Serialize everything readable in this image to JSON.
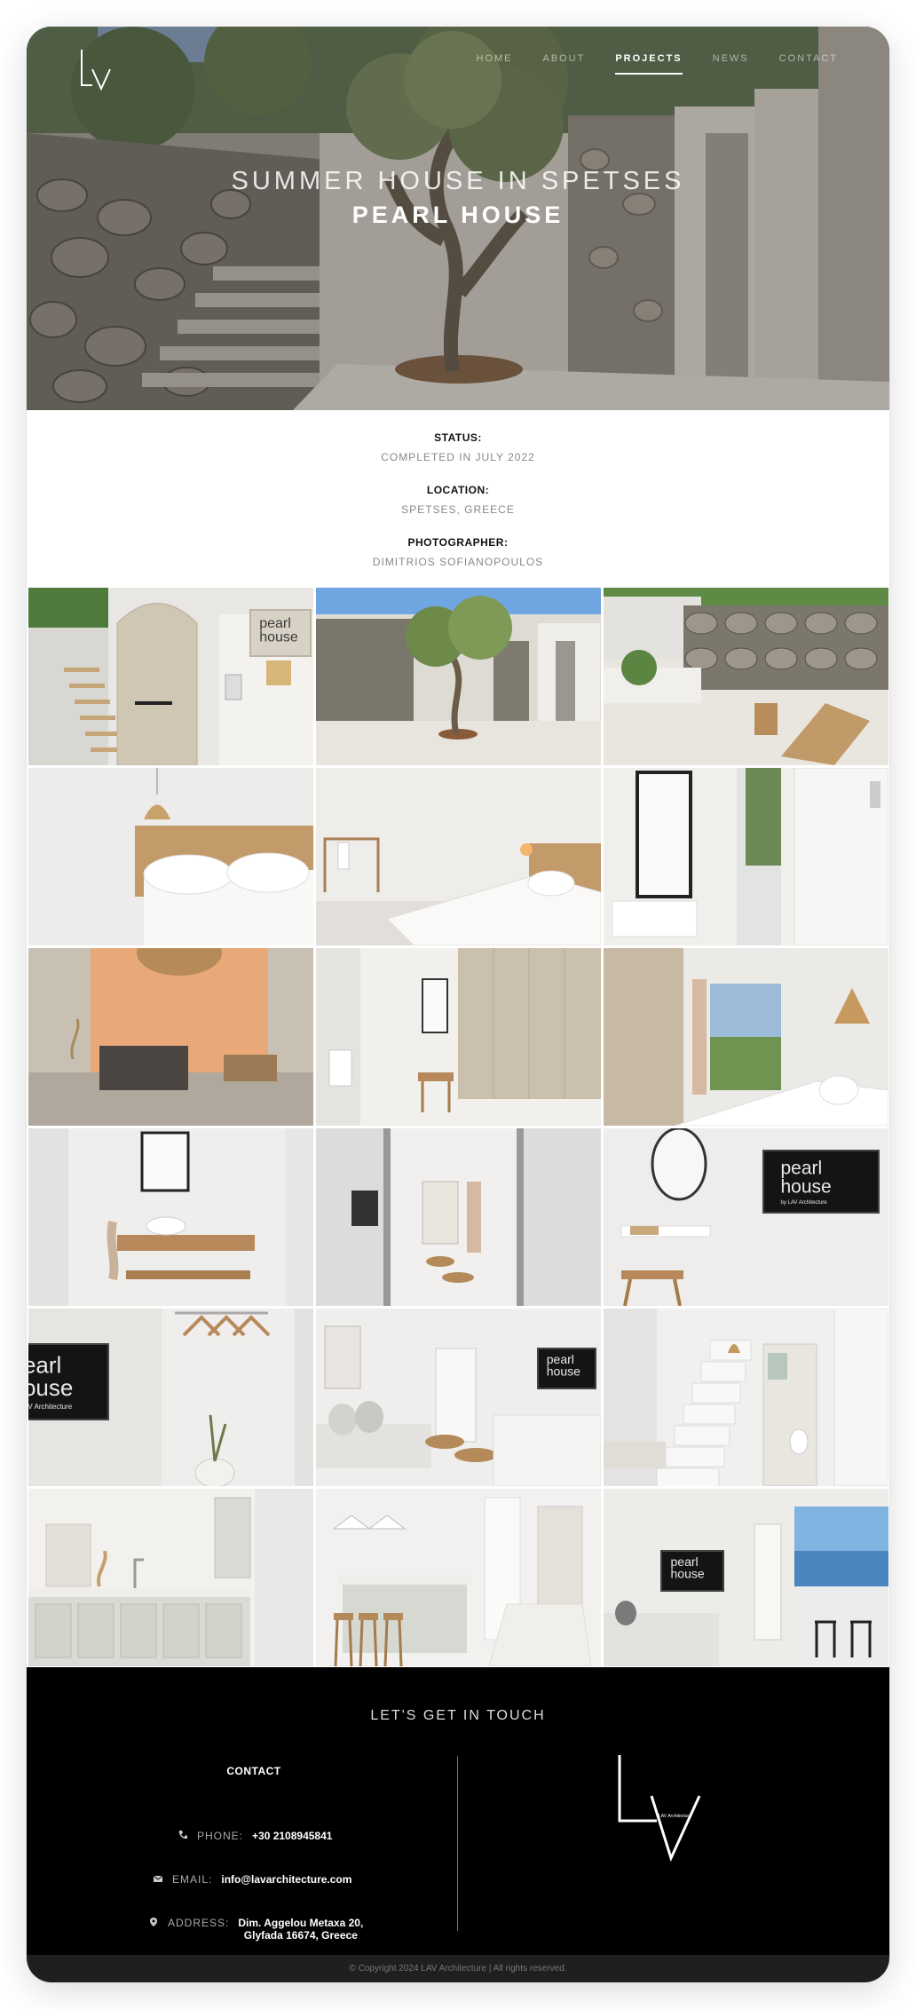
{
  "header": {
    "logo_alt": "LV",
    "nav": [
      {
        "label": "HOME",
        "active": false
      },
      {
        "label": "ABOUT",
        "active": false
      },
      {
        "label": "PROJECTS",
        "active": true
      },
      {
        "label": "NEWS",
        "active": false
      },
      {
        "label": "CONTACT",
        "active": false
      }
    ]
  },
  "hero": {
    "title": "SUMMER HOUSE IN SPETSES",
    "subtitle": "PEARL HOUSE"
  },
  "info": [
    {
      "label": "STATUS:",
      "value": "COMPLETED IN JULY 2022"
    },
    {
      "label": "LOCATION:",
      "value": "SPETSES, GREECE"
    },
    {
      "label": "PHOTOGRAPHER:",
      "value": "DIMITRIOS SOFIANOPOULOS"
    }
  ],
  "gallery": [
    {
      "name": "entrance-door-photo",
      "scene": "entrance",
      "sign_line1": "pearl",
      "sign_line2": "house",
      "sign_line3": ""
    },
    {
      "name": "courtyard-olive-photo",
      "scene": "courtyard"
    },
    {
      "name": "stone-wall-patio-photo",
      "scene": "patio"
    },
    {
      "name": "bedroom-headboard-photo",
      "scene": "bed1"
    },
    {
      "name": "bedroom-wide-photo",
      "scene": "bed2"
    },
    {
      "name": "mirror-hallway-photo",
      "scene": "mirror"
    },
    {
      "name": "stone-sink-photo",
      "scene": "sink"
    },
    {
      "name": "wardrobe-stool-photo",
      "scene": "wardrobe"
    },
    {
      "name": "bedroom-balcony-photo",
      "scene": "bed3"
    },
    {
      "name": "bathroom-vanity-photo",
      "scene": "bath"
    },
    {
      "name": "glass-doors-living-photo",
      "scene": "doors"
    },
    {
      "name": "tv-sign-mirror-photo",
      "scene": "tv",
      "sign_line1": "pearl",
      "sign_line2": "house",
      "sign_line3": "by LAV Architecture"
    },
    {
      "name": "tv-hangers-photo",
      "scene": "hangers",
      "sign_line1": "pearl",
      "sign_line2": "house",
      "sign_line3": "by LAV Architecture"
    },
    {
      "name": "living-room-photo",
      "scene": "living",
      "sign_line1": "pearl",
      "sign_line2": "house",
      "sign_line3": ""
    },
    {
      "name": "stairs-interior-photo",
      "scene": "stairs"
    },
    {
      "name": "kitchen-photo",
      "scene": "kitchen"
    },
    {
      "name": "kitchen-island-photo",
      "scene": "island"
    },
    {
      "name": "lounge-seaview-photo",
      "scene": "lounge",
      "sign_line1": "pearl",
      "sign_line2": "house",
      "sign_line3": ""
    }
  ],
  "footer": {
    "heading": "LET'S GET IN TOUCH",
    "contact_title": "CONTACT",
    "phone_label": "PHONE:",
    "phone": "+30 2108945841",
    "email_label": "EMAIL:",
    "email": "info@lavarchitecture.com",
    "address_label": "ADDRESS:",
    "address_line1": "Dim. Aggelou Metaxa 20,",
    "address_line2": "Glyfada 16674, Greece",
    "logo_caption": "LAV Architecture",
    "copyright": "© Copyright 2024  LAV Architecture | All rights reserved."
  }
}
